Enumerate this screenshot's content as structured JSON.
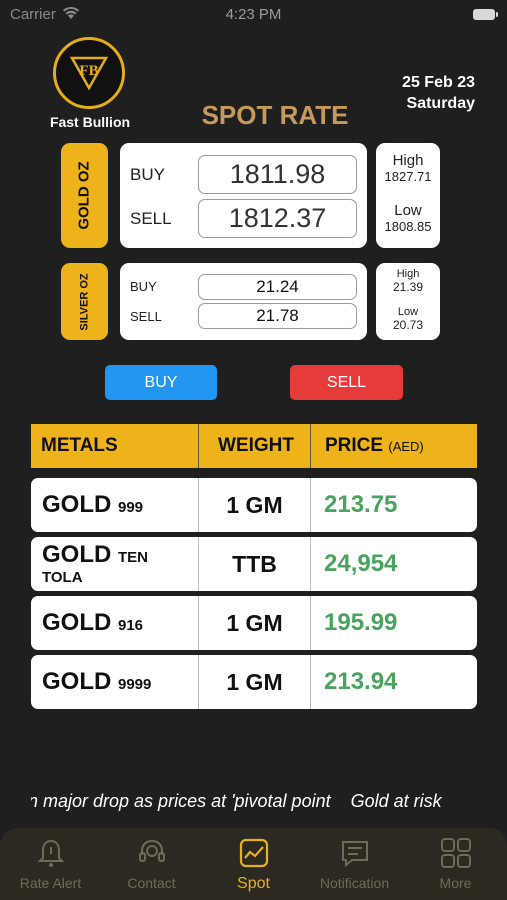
{
  "status_bar": {
    "carrier": "Carrier",
    "time": "4:23 PM"
  },
  "brand": {
    "name": "Fast Bullion",
    "logo_text": "FB"
  },
  "date": {
    "line1": "25 Feb 23",
    "line2": "Saturday"
  },
  "title": "SPOT RATE",
  "gold": {
    "label": "GOLD OZ",
    "buy_label": "BUY",
    "buy": "1811.98",
    "sell_label": "SELL",
    "sell": "1812.37",
    "high_label": "High",
    "high": "1827.71",
    "low_label": "Low",
    "low": "1808.85"
  },
  "silver": {
    "label": "SILVER OZ",
    "buy_label": "BUY",
    "buy": "21.24",
    "sell_label": "SELL",
    "sell": "21.78",
    "high_label": "High",
    "high": "21.39",
    "low_label": "Low",
    "low": "20.73"
  },
  "buttons": {
    "buy": "BUY",
    "sell": "SELL"
  },
  "table": {
    "headers": {
      "metals": "METALS",
      "weight": "WEIGHT",
      "price": "PRICE",
      "price_unit": "(AED)"
    },
    "rows": [
      {
        "metal": "GOLD",
        "purity": "999",
        "weight": "1 GM",
        "price": "213.75"
      },
      {
        "metal": "GOLD",
        "purity": "TEN",
        "purity2": "TOLA",
        "weight": "TTB",
        "price": "24,954"
      },
      {
        "metal": "GOLD",
        "purity": "916",
        "weight": "1 GM",
        "price": "195.99"
      },
      {
        "metal": "GOLD",
        "purity": "9999",
        "weight": "1 GM",
        "price": "213.94"
      }
    ]
  },
  "ticker": "n major drop as prices at 'pivotal point    Gold at risk",
  "tabs": [
    {
      "label": "Rate Alert",
      "icon": "bell-icon"
    },
    {
      "label": "Contact",
      "icon": "headset-icon"
    },
    {
      "label": "Spot",
      "icon": "chart-icon",
      "active": true
    },
    {
      "label": "Notification",
      "icon": "message-icon"
    },
    {
      "label": "More",
      "icon": "grid-icon"
    }
  ],
  "colors": {
    "accent": "#eeb21a",
    "price_green": "#4aa35e",
    "buy_blue": "#2196f3",
    "sell_red": "#e53b3b"
  }
}
